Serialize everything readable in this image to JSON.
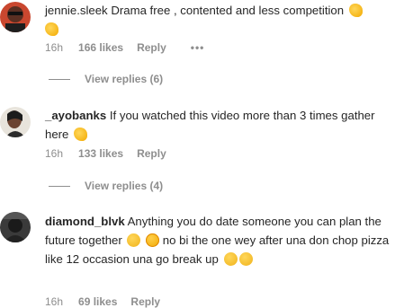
{
  "comments": [
    {
      "username": "jennie.sleek",
      "text": "Drama free , contented and less competition",
      "time": "16h",
      "likes": "166 likes",
      "reply": "Reply",
      "more": "•••",
      "view_replies": "View replies (6)"
    },
    {
      "username": "_ayobanks",
      "text": "If you watched this video more than 3 times gather here",
      "time": "16h",
      "likes": "133 likes",
      "reply": "Reply",
      "view_replies": "View replies (4)"
    },
    {
      "username": "diamond_blvk",
      "text_a": "Anything you do date someone you can plan the future together",
      "text_b": "no bi the one wey after una don chop pizza like 12 occasion una go break up",
      "time": "16h",
      "likes": "69 likes",
      "reply": "Reply"
    }
  ]
}
